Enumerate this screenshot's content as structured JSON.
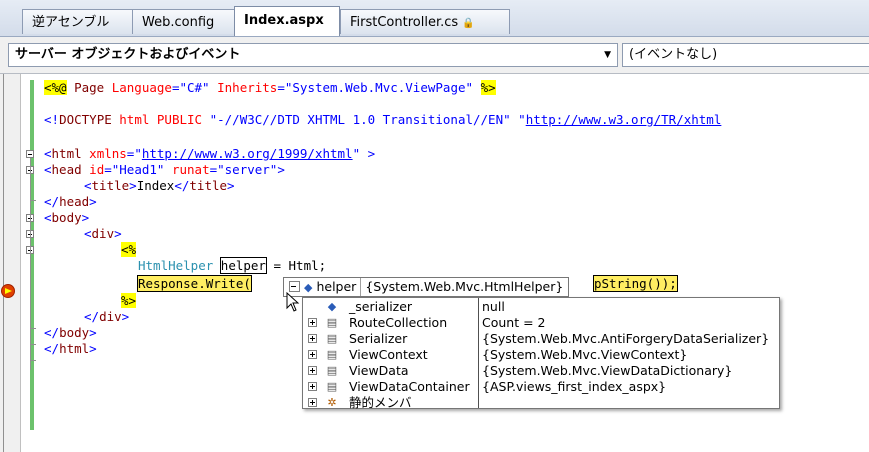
{
  "tabs": [
    {
      "label": "逆アセンブル"
    },
    {
      "label": "Web.config"
    },
    {
      "label": "Index.aspx",
      "active": true
    },
    {
      "label": "FirstController.cs",
      "icon": "lock-icon"
    }
  ],
  "navbar": {
    "left_combo": "サーバー オブジェクトおよびイベント",
    "right_combo": "(イベントなし)"
  },
  "code": {
    "l1_open": "<%@",
    "l1_mid": " Page ",
    "l1_a1": "Language",
    "l1_eq1": "=",
    "l1_v1": "\"C#\"",
    "l1_sp": " ",
    "l1_a2": "Inherits",
    "l1_eq2": "=",
    "l1_v2": "\"System.Web.Mvc.ViewPage\"",
    "l1_close": "%>",
    "l2_b": "<!",
    "l2_t": "DOCTYPE",
    "l2_a": " html PUBLIC ",
    "l2_v": "\"-//W3C//DTD XHTML 1.0 Transitional//EN\"",
    "l2_sp": " \"",
    "l2_link": "http://www.w3.org/TR/xhtml",
    "l3_lt": "<",
    "l3_t": "html",
    "l3_a": " xmlns",
    "l3_eq": "=",
    "l3_q": "\"",
    "l3_link": "http://www.w3.org/1999/xhtml",
    "l3_q2": "\"",
    "l3_gt": " >",
    "l4_lt": "<",
    "l4_t": "head",
    "l4_a1": " id",
    "l4_eq1": "=",
    "l4_v1": "\"Head1\"",
    "l4_a2": " runat",
    "l4_eq2": "=",
    "l4_v2": "\"server\"",
    "l4_gt": ">",
    "l5_lt": "<",
    "l5_t": "title",
    "l5_gt": ">",
    "l5_text": "Index",
    "l5_lt2": "</",
    "l5_t2": "title",
    "l5_gt2": ">",
    "l6_lt": "</",
    "l6_t": "head",
    "l6_gt": ">",
    "l7_lt": "<",
    "l7_t": "body",
    "l7_gt": ">",
    "l8_lt": "<",
    "l8_t": "div",
    "l8_gt": ">",
    "l9_open": "<%",
    "l10_type": "HtmlHelper",
    "l10_sp": " ",
    "l10_var": "helper",
    "l10_rest": " = Html;",
    "l11_exec": "Response.Write(",
    "l11_exec2": "pString());",
    "l12_close": "%>",
    "l13_lt": "</",
    "l13_t": "div",
    "l13_gt": ">",
    "l14_lt": "</",
    "l14_t": "body",
    "l14_gt": ">",
    "l15_lt": "</",
    "l15_t": "html",
    "l15_gt": ">"
  },
  "datatip": {
    "name": "helper",
    "value": "{System.Web.Mvc.HtmlHelper}",
    "rows": [
      {
        "name": "_serializer",
        "value": "null",
        "expandable": false,
        "icon": "field-icon"
      },
      {
        "name": "RouteCollection",
        "value": "Count = 2",
        "expandable": true,
        "icon": "property-icon"
      },
      {
        "name": "Serializer",
        "value": "{System.Web.Mvc.AntiForgeryDataSerializer}",
        "expandable": true,
        "icon": "property-icon"
      },
      {
        "name": "ViewContext",
        "value": "{System.Web.Mvc.ViewContext}",
        "expandable": true,
        "icon": "property-icon"
      },
      {
        "name": "ViewData",
        "value": "{System.Web.Mvc.ViewDataDictionary}",
        "expandable": true,
        "icon": "property-icon"
      },
      {
        "name": "ViewDataContainer",
        "value": "{ASP.views_first_index_aspx}",
        "expandable": true,
        "icon": "property-icon"
      },
      {
        "name": "静的メンバ",
        "value": "",
        "expandable": true,
        "icon": "static-members-icon"
      }
    ]
  }
}
